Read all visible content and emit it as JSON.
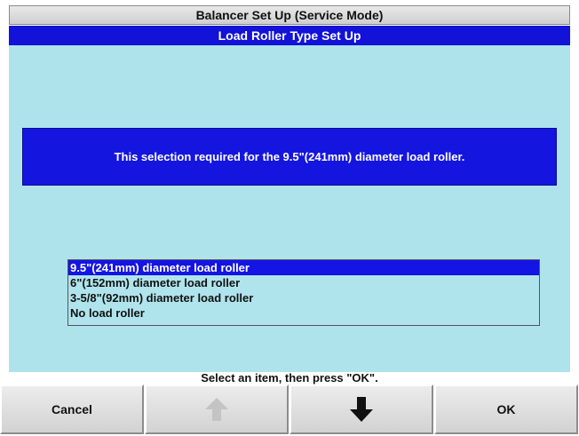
{
  "window": {
    "title": "Balancer Set Up (Service Mode)",
    "subtitle": "Load Roller Type Set Up"
  },
  "message": "This selection required for the 9.5\"(241mm) diameter load roller.",
  "list": {
    "selected_index": 0,
    "items": [
      "9.5\"(241mm) diameter load roller",
      "6\"(152mm) diameter load roller",
      "3-5/8\"(92mm) diameter load roller",
      "No load roller"
    ]
  },
  "prompt": "Select an item, then press \"OK\".",
  "buttons": {
    "cancel_label": "Cancel",
    "up_icon": "arrow-up-icon",
    "down_icon": "arrow-down-icon",
    "ok_label": "OK"
  },
  "colors": {
    "content_bg": "#aee3ec",
    "highlight_blue": "#1414e4",
    "disabled_arrow": "#b8b8b8"
  }
}
